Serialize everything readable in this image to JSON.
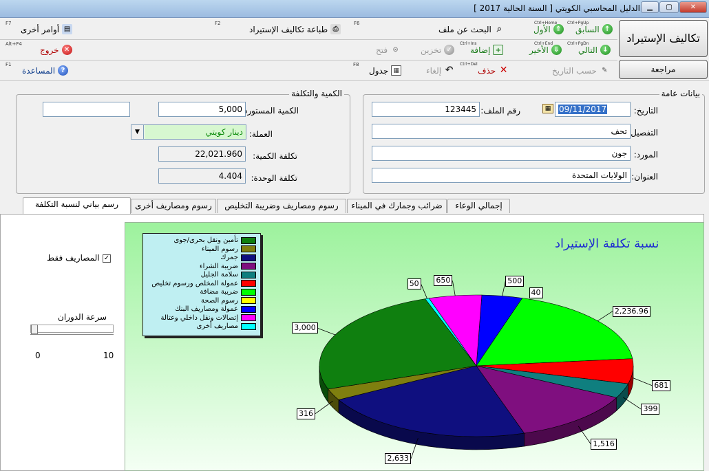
{
  "window": {
    "title": "الدليل المحاسبي الكويتي  [ السنة الحالية 2017 ]",
    "min_icon": "minimize-icon",
    "max_icon": "maximize-icon",
    "close_icon": "close-icon"
  },
  "buttons": {
    "import_costs": "تكاليف الإستيراد",
    "review": "مراجعة"
  },
  "toolbar1": {
    "prev": {
      "label": "السابق",
      "shortcut": "Ctrl+PgUp"
    },
    "first": {
      "label": "الأول",
      "shortcut": "Ctrl+Home"
    },
    "search": {
      "label": "البحث عن ملف",
      "fkey": "F6"
    },
    "print": {
      "label": "طباعة تكاليف الإستيراد",
      "fkey": "F2"
    },
    "other": {
      "label": "أوامر أخرى",
      "fkey": "F7"
    }
  },
  "toolbar2": {
    "next": {
      "label": "التالي",
      "shortcut": "Ctrl+PgDn"
    },
    "last": {
      "label": "الأخير",
      "shortcut": "Ctrl+End"
    },
    "add": {
      "label": "إضافة",
      "shortcut": "Ctrl+Ins"
    },
    "save": {
      "label": "تخزين"
    },
    "open": {
      "label": "فتح"
    },
    "exit": {
      "label": "خروج",
      "fkey": "Alt+F4"
    }
  },
  "toolbar3": {
    "calc_date": {
      "label": "حسب التاريخ"
    },
    "delete": {
      "label": "حذف",
      "shortcut": "Ctrl+Del"
    },
    "cancel": {
      "label": "إلغاء"
    },
    "table": {
      "label": "جدول",
      "fkey": "F8"
    },
    "help": {
      "label": "المساعدة",
      "fkey": "F1"
    }
  },
  "general": {
    "title": "بيانات عامة",
    "date_label": "التاريخ:",
    "date_value": "09/11/2017",
    "file_label": "رقم الملف:",
    "file_value": "123445",
    "detail_label": "التفصيل:",
    "detail_value": "تحف",
    "supplier_label": "المورد:",
    "supplier_value": "جون",
    "address_label": "العنوان:",
    "address_value": "الولايات المتحدة"
  },
  "qty": {
    "title": "الكمية والتكلفة",
    "imported_label": "الكمية المستوردة:",
    "imported_value": "5,000",
    "extra_value": "",
    "currency_label": "العملة:",
    "currency_value": "دينار كويتي",
    "qty_cost_label": "تكلفة الكمية:",
    "qty_cost_value": "22,021.960",
    "unit_cost_label": "تكلفة الوحدة:",
    "unit_cost_value": "4.404"
  },
  "tabs": [
    "إجمالي الوعاء",
    "ضرائب وجمارك في الميناء",
    "رسوم ومصاريف وضريبة التخليص",
    "رسوم ومصاريف أخرى",
    "رسم بياني لنسبة التكلفة"
  ],
  "side": {
    "expenses_only": "المصاريف فقط",
    "rotation_speed": "سرعة الدوران",
    "slider_min": "0",
    "slider_max": "10",
    "slider_value": 0
  },
  "chart_data": {
    "type": "pie",
    "title": "نسبة تكلفة الإستيراد",
    "legend_placement": "top-left",
    "categories": [
      "تأمين ونقل بحرى/جوى",
      "رسوم الميناء",
      "جمرك",
      "ضريبة الشراء",
      "سلامة الجليل",
      "عمولة المخلص ورسوم تخليص",
      "ضريبة مضافة",
      "رسوم الصحة",
      "عمولة ومصاريف البنك",
      "إتصالات ونقل داخلي وعتالة",
      "مصاريف أخرى"
    ],
    "colors": [
      "#0f7f0f",
      "#7f7f0f",
      "#0f0f7f",
      "#7f0f7f",
      "#0f7f7f",
      "#ff0000",
      "#00ff00",
      "#ffff00",
      "#0000ff",
      "#ff00ff",
      "#00ffff"
    ],
    "values": [
      3000,
      316,
      2633,
      1516,
      399,
      681,
      2236.96,
      0,
      500,
      650,
      50
    ],
    "labels": [
      "3,000",
      "316",
      "2,633",
      "1,516",
      "399",
      "681",
      "2,236.96",
      "",
      "500",
      "650",
      "50"
    ],
    "extra_label": "40"
  }
}
